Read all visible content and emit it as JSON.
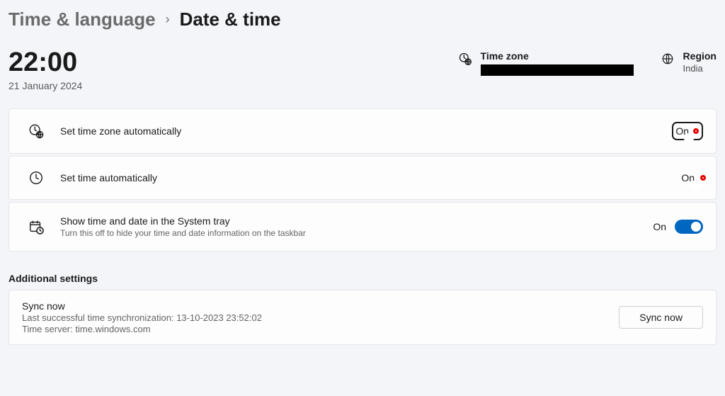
{
  "breadcrumb": {
    "parent": "Time & language",
    "separator": "›",
    "current": "Date & time"
  },
  "clock": {
    "time": "22:00",
    "date": "21 January 2024"
  },
  "timezone": {
    "label": "Time zone",
    "value": ""
  },
  "region": {
    "label": "Region",
    "value": "India"
  },
  "settings": {
    "set_tz_auto": {
      "title": "Set time zone automatically",
      "state_label": "On",
      "on": true
    },
    "set_time_auto": {
      "title": "Set time automatically",
      "state_label": "On",
      "on": true
    },
    "tray": {
      "title": "Show time and date in the System tray",
      "subtitle": "Turn this off to hide your time and date information on the taskbar",
      "state_label": "On",
      "on": true
    }
  },
  "additional": {
    "heading": "Additional settings",
    "sync": {
      "title": "Sync now",
      "last_sync": "Last successful time synchronization: 13-10-2023 23:52:02",
      "server": "Time server: time.windows.com",
      "button": "Sync now"
    }
  }
}
